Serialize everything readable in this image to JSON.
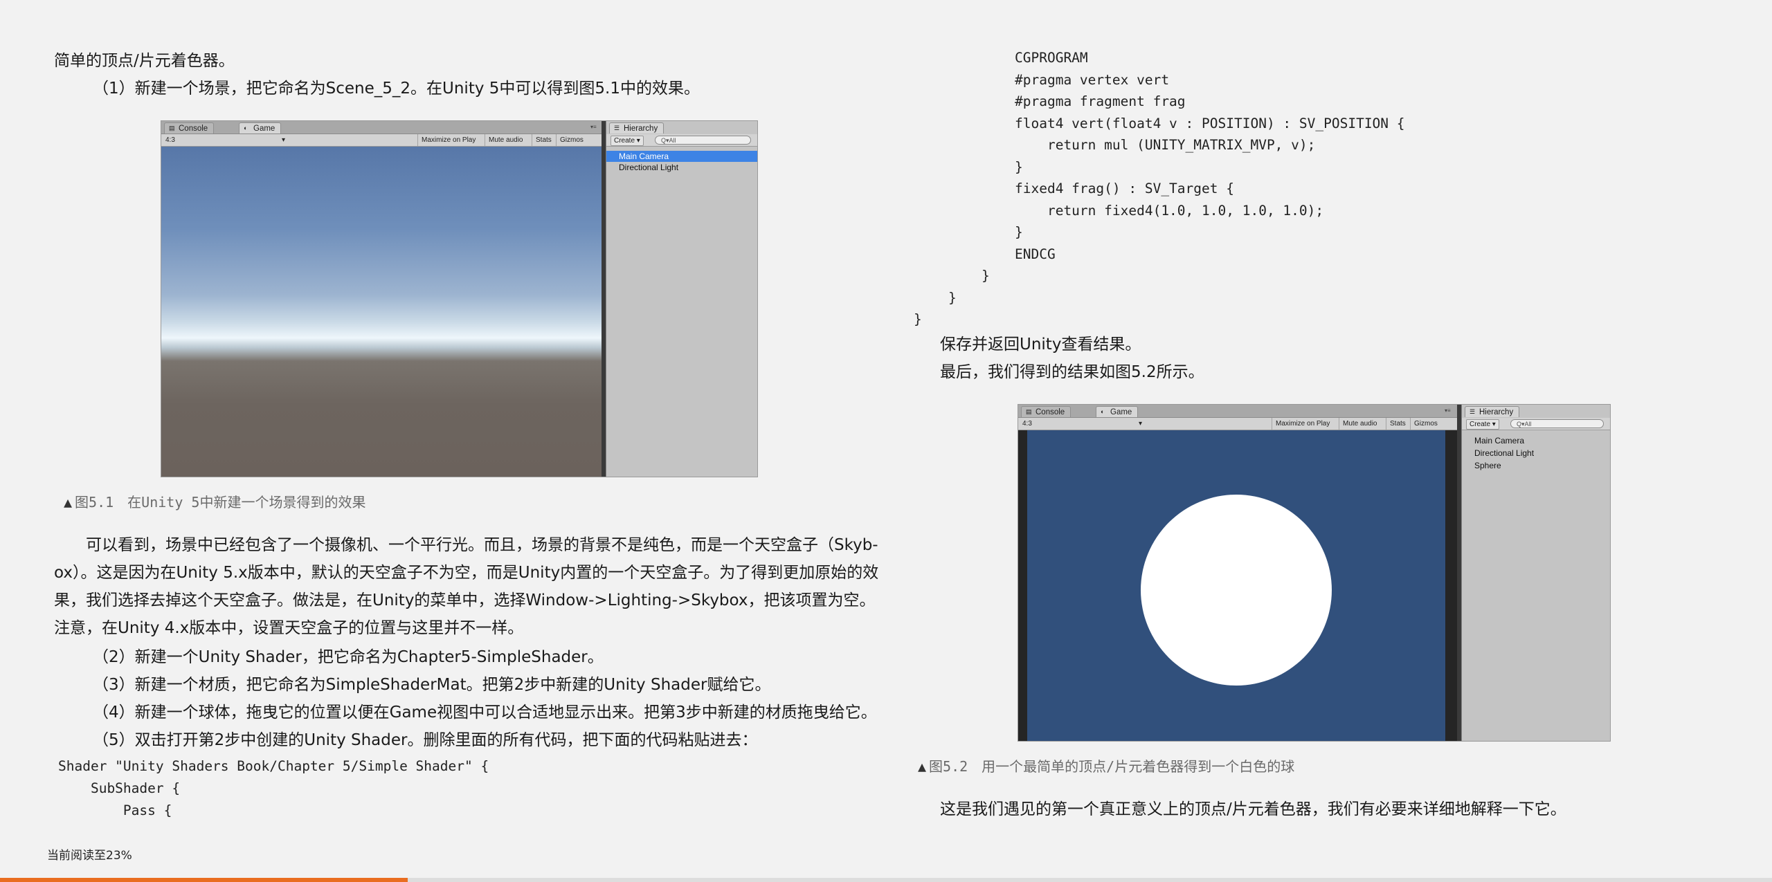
{
  "left": {
    "para_intro": "简单的顶点/片元着色器。",
    "step1": "（1）新建一个场景，把它命名为Scene_5_2。在Unity 5中可以得到图5.1中的效果。",
    "fig1": {
      "tabs": {
        "console": "Console",
        "game": "Game"
      },
      "aspect": "4:3",
      "toolbar": {
        "maximize": "Maximize on Play",
        "mute": "Mute audio",
        "stats": "Stats",
        "gizmos": "Gizmos"
      },
      "hierarchy": {
        "tab": "Hierarchy",
        "create": "Create",
        "search": "Q▾All",
        "items": [
          "Main Camera",
          "Directional Light"
        ],
        "selected_index": 0
      },
      "caption": "图5.1　在Unity 5中新建一个场景得到的效果"
    },
    "body_lines": [
      "可以看到，场景中已经包含了一个摄像机、一个平行光。而且，场景的背景不是纯色，而是一个天空盒子（Skyb-",
      "ox）。这是因为在Unity 5.x版本中，默认的天空盒子不为空，而是Unity内置的一个天空盒子。为了得到更加原始的效",
      "果，我们选择去掉这个天空盒子。做法是，在Unity的菜单中，选择Window->Lighting->Skybox，把该项置为空。",
      "注意，在Unity 4.x版本中，设置天空盒子的位置与这里并不一样。"
    ],
    "steps": [
      "（2）新建一个Unity Shader，把它命名为Chapter5-SimpleShader。",
      "（3）新建一个材质，把它命名为SimpleShaderMat。把第2步中新建的Unity Shader赋给它。",
      "（4）新建一个球体，拖曳它的位置以便在Game视图中可以合适地显示出来。把第3步中新建的材质拖曳给它。",
      "（5）双击打开第2步中创建的Unity Shader。删除里面的所有代码，把下面的代码粘贴进去："
    ],
    "code_lines": [
      "Shader \"Unity Shaders Book/Chapter 5/Simple Shader\" {",
      "    SubShader {",
      "        Pass {"
    ]
  },
  "right": {
    "code_lines": [
      "CGPROGRAM",
      "#pragma vertex vert",
      "#pragma fragment frag",
      "float4 vert(float4 v : POSITION) : SV_POSITION {",
      "    return mul (UNITY_MATRIX_MVP, v);",
      "}",
      "fixed4 frag() : SV_Target {",
      "    return fixed4(1.0, 1.0, 1.0, 1.0);",
      "}",
      "ENDCG"
    ],
    "closing_braces": [
      "}",
      "}",
      "}"
    ],
    "para_save": "保存并返回Unity查看结果。",
    "para_result": "最后，我们得到的结果如图5.2所示。",
    "fig2": {
      "tabs": {
        "console": "Console",
        "game": "Game"
      },
      "aspect": "4:3",
      "toolbar": {
        "maximize": "Maximize on Play",
        "mute": "Mute audio",
        "stats": "Stats",
        "gizmos": "Gizmos"
      },
      "hierarchy": {
        "tab": "Hierarchy",
        "create": "Create",
        "search": "Q▾All",
        "items": [
          "Main Camera",
          "Directional Light",
          "Sphere"
        ]
      },
      "caption": "图5.2　用一个最简单的顶点/片元着色器得到一个白色的球"
    },
    "para_final": "这是我们遇见的第一个真正意义上的顶点/片元着色器，我们有必要来详细地解释一下它。"
  },
  "footer": {
    "reading_progress_label": "当前阅读至23%",
    "progress_fraction": 0.23
  },
  "colors": {
    "page_bg": "#f2f2f2",
    "progress_accent": "#e96d20",
    "selection_blue": "#3d83e5",
    "game_bg_blue": "#31507c",
    "sky_top": "#5b7db0",
    "ground": "#6b625c"
  }
}
